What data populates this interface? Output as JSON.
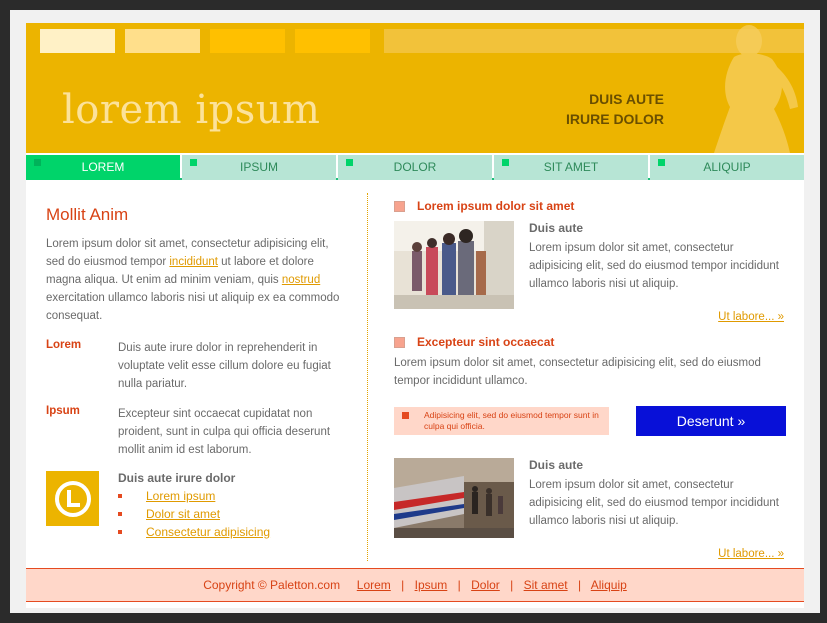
{
  "header": {
    "logo": "lorem ipsum",
    "tagline_line1": "DUIS AUTE",
    "tagline_line2": "IRURE DOLOR"
  },
  "nav": [
    "LOREM",
    "IPSUM",
    "DOLOR",
    "SIT AMET",
    "ALIQUIP"
  ],
  "left": {
    "title": "Mollit Anim",
    "intro_1": "Lorem ipsum dolor sit amet, consectetur adipisicing elit, sed do eiusmod tempor ",
    "intro_link_1": "incididunt",
    "intro_2": " ut labore et dolore magna aliqua. Ut enim ad minim veniam, quis ",
    "intro_link_2": "nostrud",
    "intro_3": " exercitation ullamco laboris nisi ut aliquip ex ea commodo consequat.",
    "defs": [
      {
        "term": "Lorem",
        "desc": "Duis aute irure dolor in reprehenderit in voluptate velit esse cillum dolore eu fugiat nulla pariatur."
      },
      {
        "term": "Ipsum",
        "desc": "Excepteur sint occaecat cupidatat non proident, sunt in culpa qui officia deserunt mollit anim id est laborum."
      }
    ],
    "box_title": "Duis aute irure dolor",
    "box_links": [
      "Lorem ipsum",
      "Dolor sit amet",
      "Consectetur adipisicing"
    ]
  },
  "right": {
    "section1_title": "Lorem ipsum dolor sit amet",
    "item1_sub": "Duis aute",
    "item1_text": "Lorem ipsum dolor sit amet, consectetur adipisicing elit, sed do eiusmod tempor incididunt ullamco laboris nisi ut aliquip.",
    "more_1": "Ut labore... »",
    "section2_title": "Excepteur sint occaecat",
    "section2_text": "Lorem ipsum dolor sit amet, consectetur adipisicing elit, sed do eiusmod tempor incididunt ullamco.",
    "notice": "Adipisicing elit, sed do eiusmod tempor sunt in culpa qui officia.",
    "cta": "Deserunt »",
    "item2_sub": "Duis aute",
    "item2_text": "Lorem ipsum dolor sit amet, consectetur adipisicing elit, sed do eiusmod tempor incididunt ullamco laboris nisi ut aliquip.",
    "more_2": "Ut labore... »"
  },
  "footer": {
    "copyright": "Copyright © Paletton.com",
    "links": [
      "Lorem",
      "Ipsum",
      "Dolor",
      "Sit amet",
      "Aliquip"
    ]
  },
  "colors": {
    "header": "#ecb400",
    "nav_active": "#00d46a",
    "nav_bg": "#b7e5d5",
    "accent": "#d84315",
    "link": "#e09a00",
    "cta": "#0810d8",
    "footer_bg": "#ffd7c9"
  }
}
